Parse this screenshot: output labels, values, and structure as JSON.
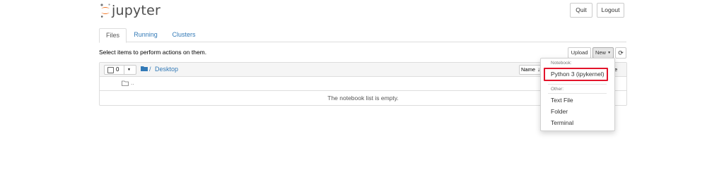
{
  "header": {
    "logo_text": "jupyter",
    "quit_label": "Quit",
    "logout_label": "Logout"
  },
  "tabs": [
    {
      "label": "Files",
      "active": true
    },
    {
      "label": "Running",
      "active": false
    },
    {
      "label": "Clusters",
      "active": false
    }
  ],
  "toolbar": {
    "hint": "Select items to perform actions on them.",
    "upload_label": "Upload",
    "new_label": "New",
    "refresh_icon": "refresh-icon"
  },
  "file_list": {
    "selected_count": "0",
    "breadcrumb_separator": "/",
    "breadcrumb_current": "Desktop",
    "sort_name_label": "Name",
    "header_right_fragment": "e",
    "parent_dir_label": "..",
    "empty_message": "The notebook list is empty."
  },
  "new_menu": {
    "notebook_header": "Notebook:",
    "notebook_items": [
      "Python 3 (ipykernel)"
    ],
    "other_header": "Other:",
    "other_items": [
      "Text File",
      "Folder",
      "Terminal"
    ],
    "highlight_color": "#e3142b"
  },
  "colors": {
    "link": "#337ab7",
    "logo_orange": "#f37726"
  }
}
